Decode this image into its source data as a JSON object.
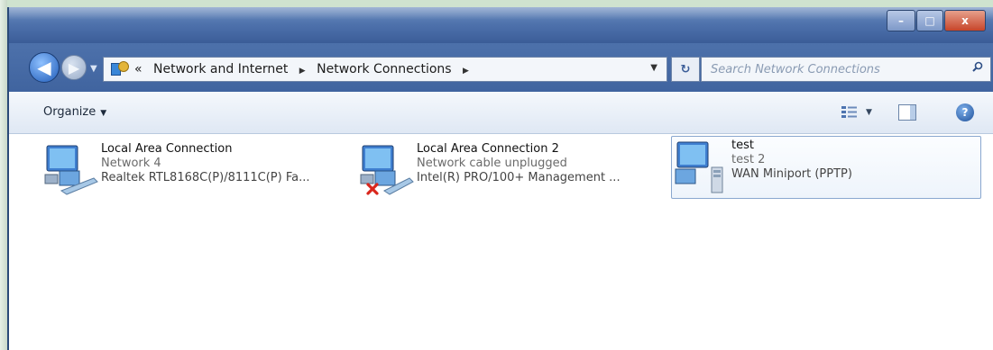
{
  "window": {
    "caption_min": "–",
    "caption_max": "□",
    "caption_close": "x"
  },
  "navigation": {
    "back_glyph": "◀",
    "forward_glyph": "▶",
    "address": {
      "overflow": "«",
      "crumbs": [
        "Network and Internet",
        "Network Connections"
      ],
      "separator": "▶"
    },
    "refresh_glyph": "↻",
    "search_placeholder": "Search Network Connections"
  },
  "toolbar": {
    "organize_label": "Organize",
    "caret": "▼",
    "help_glyph": "?"
  },
  "connections": [
    {
      "name": "Local Area Connection",
      "status": "Network 4",
      "device": "Realtek RTL8168C(P)/8111C(P) Fa...",
      "icon": "network-adapter-icon",
      "disconnected": false,
      "selected": false
    },
    {
      "name": "Local Area Connection 2",
      "status": "Network cable unplugged",
      "device": "Intel(R) PRO/100+ Management ...",
      "icon": "network-adapter-icon",
      "disconnected": true,
      "selected": false
    },
    {
      "name": "test",
      "status": "test 2",
      "device": "WAN Miniport (PPTP)",
      "icon": "vpn-connection-icon",
      "disconnected": false,
      "selected": true
    }
  ],
  "colors": {
    "titlebar": "#4f73ad",
    "close_button": "#c7452a",
    "selection_border": "#8aa7cf",
    "error_x": "#d9261c"
  }
}
